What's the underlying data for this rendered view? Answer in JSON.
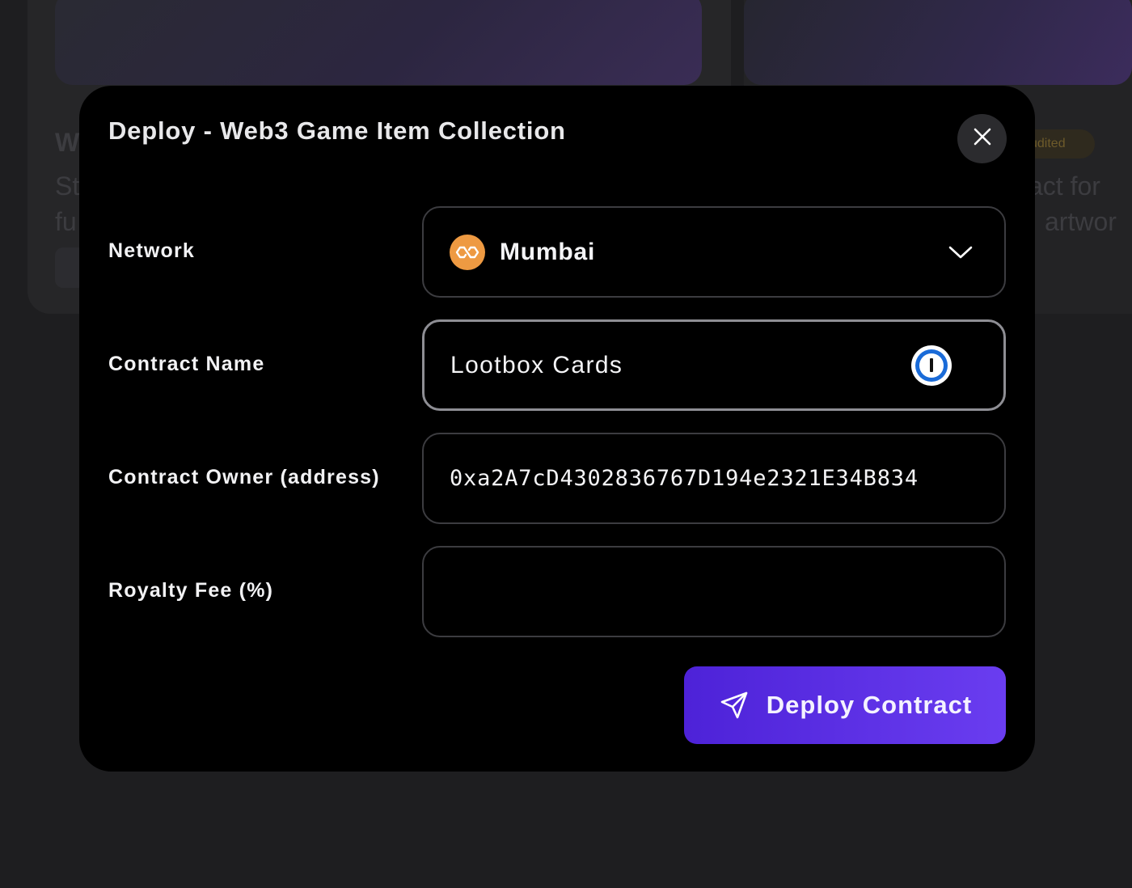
{
  "background": {
    "card_title": "W",
    "card_desc_line1": "St",
    "card_desc_line2": "fu",
    "right_badge": "udited",
    "right_desc_line1": "act for",
    "right_desc_line2": "artwor"
  },
  "modal": {
    "title": "Deploy - Web3 Game Item Collection",
    "close_icon": "close-icon"
  },
  "form": {
    "network": {
      "label": "Network",
      "value": "Mumbai",
      "icon": "polygon-icon",
      "accent": "#ee9a42"
    },
    "contract_name": {
      "label": "Contract Name",
      "value": "Lootbox Cards",
      "icon": "password-manager-icon"
    },
    "contract_owner": {
      "label": "Contract Owner (address)",
      "value": "0xa2A7cD4302836767D194e2321E34B834"
    },
    "royalty_fee": {
      "label": "Royalty Fee (%)",
      "value": ""
    }
  },
  "actions": {
    "deploy_label": "Deploy Contract",
    "deploy_icon": "send-icon",
    "accent": "#5a2ee6"
  }
}
